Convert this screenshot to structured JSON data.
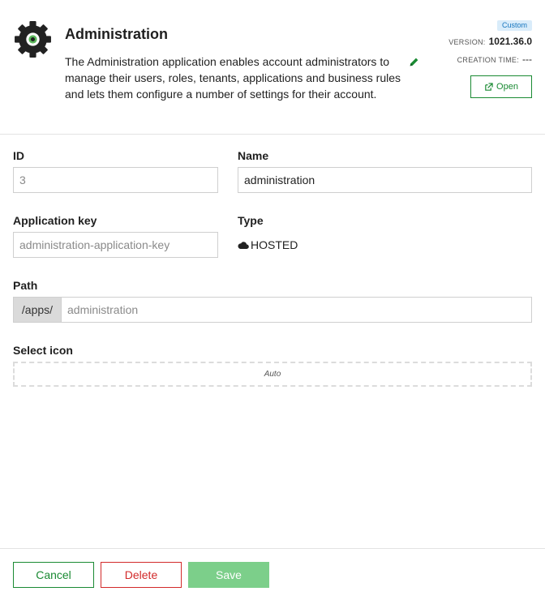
{
  "app": {
    "title": "Administration",
    "description": "The Administration application enables account administrators to manage their users, roles, tenants, applications and business rules and lets them configure a number of settings for their account.",
    "icon": "gear-icon",
    "badge": "Custom",
    "version_label": "VERSION:",
    "version_value": "1021.36.0",
    "creation_label": "CREATION TIME:",
    "creation_value": "---",
    "open_label": "Open"
  },
  "form": {
    "id_label": "ID",
    "id_value": "3",
    "name_label": "Name",
    "name_value": "administration",
    "key_label": "Application key",
    "key_value": "administration-application-key",
    "type_label": "Type",
    "type_value": "HOSTED",
    "path_label": "Path",
    "path_prefix": "/apps/",
    "path_value": "administration",
    "select_icon_label": "Select icon",
    "select_icon_value": "Auto"
  },
  "footer": {
    "cancel_label": "Cancel",
    "delete_label": "Delete",
    "save_label": "Save"
  },
  "colors": {
    "accent_green": "#1a8a33",
    "danger_red": "#d22a2a",
    "save_disabled": "#7ccf8a",
    "badge_bg": "#d9ecfa",
    "badge_text": "#1776bf"
  }
}
